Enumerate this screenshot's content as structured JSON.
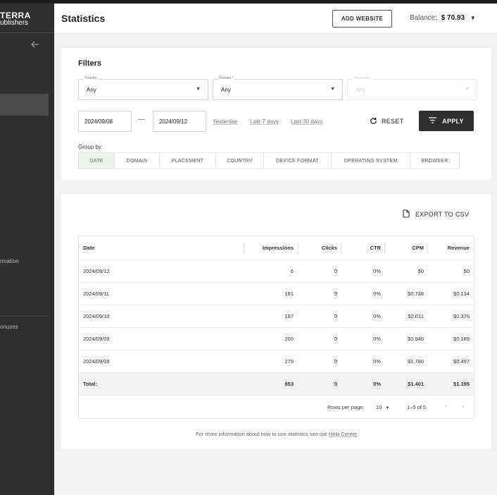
{
  "sidebar": {
    "logo_line1": "TERRA",
    "logo_line2": "ublishers",
    "back_icon": "arrow-left-icon",
    "item_information": "rmation",
    "item_bonuses": "onuses"
  },
  "header": {
    "title": "Statistics",
    "add_website_label": "ADD WEBSITE",
    "balance_label": "Balance:",
    "balance_value": "$  70.93"
  },
  "filters": {
    "title": "Filters",
    "country": {
      "label": "Country",
      "value": "Any"
    },
    "domain": {
      "label": "Domain *",
      "value": "Any"
    },
    "placement": {
      "label": "Placement",
      "value": "Any",
      "disabled": true
    },
    "date_from": "2024/09/08",
    "date_to": "2024/09/12",
    "date_separator": "—",
    "quick_ranges": [
      "Yesterday",
      "Last 7 days",
      "Last 30 days"
    ],
    "reset_label": "RESET",
    "apply_label": "APPLY",
    "group_by_label": "Group by:",
    "group_by_options": [
      "DATE",
      "DOMAIN",
      "PLACEMENT",
      "COUNTRY",
      "DEVICE FORMAT",
      "OPERATING SYSTEM",
      "BROWSER"
    ],
    "group_by_selected": "DATE"
  },
  "table": {
    "export_label": "EXPORT TO CSV",
    "columns": [
      "Date",
      "Impressions",
      "Clicks",
      "CTR",
      "CPM",
      "Revenue"
    ],
    "rows": [
      [
        "2024/09/12",
        "6",
        "0",
        "0%",
        "$0",
        "$0"
      ],
      [
        "2024/09/11",
        "181",
        "0",
        "0%",
        "$0.738",
        "$0.134"
      ],
      [
        "2024/09/10",
        "187",
        "0",
        "0%",
        "$2.011",
        "$0.376"
      ],
      [
        "2024/09/09",
        "200",
        "0",
        "0%",
        "$0.946",
        "$0.189"
      ],
      [
        "2024/09/08",
        "279",
        "0",
        "0%",
        "$1.780",
        "$0.497"
      ]
    ],
    "total": [
      "Total:",
      "853",
      "0",
      "0%",
      "$1.401",
      "$1.195"
    ],
    "rows_per_page_label": "Rows per page:",
    "rows_per_page_value": "10",
    "range_text": "1–5 of 5"
  },
  "footer": {
    "note": "For more information about how to use statistics see our",
    "link_text": "Help Center"
  },
  "colors": {
    "sidebar_bg": "#2f2f2f",
    "apply_bg": "#2f2f2f",
    "tab_active_bg": "#eaf3e8",
    "tab_active_text": "#4e8a42"
  }
}
